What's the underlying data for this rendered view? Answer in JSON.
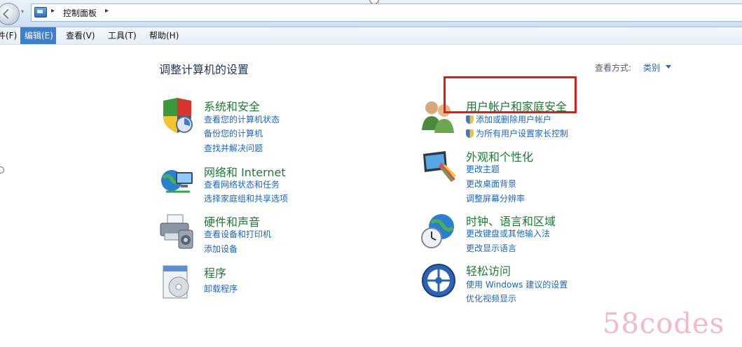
{
  "address_bar": {
    "dropdown_glyph": "▾",
    "arrow_glyph": "▸",
    "path": "控制面板"
  },
  "menu": [
    "件(F)",
    "编辑(E)",
    "查看(V)",
    "工具(T)",
    "帮助(H)"
  ],
  "header": {
    "title": "调整计算机的设置",
    "view_label": "查看方式:",
    "view_value": "类别"
  },
  "categories": [
    {
      "title": "系统和安全",
      "icon": "shield-security-icon",
      "links": [
        "查看您的计算机状态",
        "备份您的计算机",
        "查找并解决问题"
      ]
    },
    {
      "title": "网络和 Internet",
      "icon": "network-globe-icon",
      "links": [
        "查看网络状态和任务",
        "选择家庭组和共享选项"
      ]
    },
    {
      "title": "硬件和声音",
      "icon": "printer-speaker-icon",
      "links": [
        "查看设备和打印机",
        "添加设备"
      ]
    },
    {
      "title": "程序",
      "icon": "programs-disc-icon",
      "links": [
        "卸载程序"
      ]
    },
    {
      "title": "用户帐户和家庭安全",
      "icon": "users-icon",
      "links": [
        "添加或删除用户帐户",
        "为所有用户设置家长控制"
      ]
    },
    {
      "title": "外观和个性化",
      "icon": "appearance-monitor-icon",
      "links": [
        "更改主题",
        "更改桌面背景",
        "调整屏幕分辨率"
      ]
    },
    {
      "title": "时钟、语言和区域",
      "icon": "clock-globe-icon",
      "links": [
        "更改键盘或其他输入法",
        "更改显示语言"
      ]
    },
    {
      "title": "轻松访问",
      "icon": "ease-of-access-icon",
      "links": [
        "使用 Windows 建议的设置",
        "优化视频显示"
      ]
    }
  ],
  "watermark": "58codes",
  "colors": {
    "title_green": "#1c7a35",
    "link_blue": "#1a66c9",
    "highlight_red": "#e11b1b"
  }
}
